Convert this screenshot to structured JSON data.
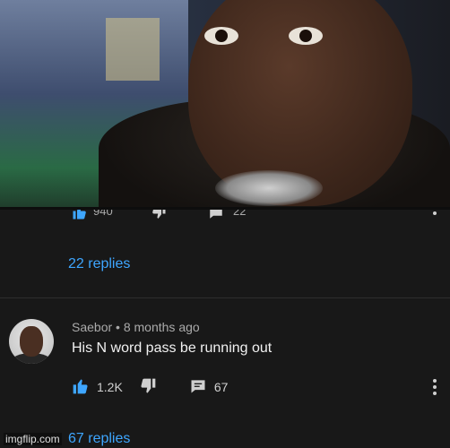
{
  "top_row": {
    "likes_partial": "940",
    "replies_partial": "22"
  },
  "thread1": {
    "replies_link": "22 replies"
  },
  "comment": {
    "author": "Saebor",
    "separator": "•",
    "time": "8 months ago",
    "text": "His N word pass be running out",
    "like_count": "1.2K",
    "reply_count": "67"
  },
  "thread2": {
    "replies_link": "67 replies"
  },
  "watermark": "imgflip.com",
  "colors": {
    "link": "#3ea6ff",
    "background": "#181818",
    "meta": "#aaaaaa"
  }
}
